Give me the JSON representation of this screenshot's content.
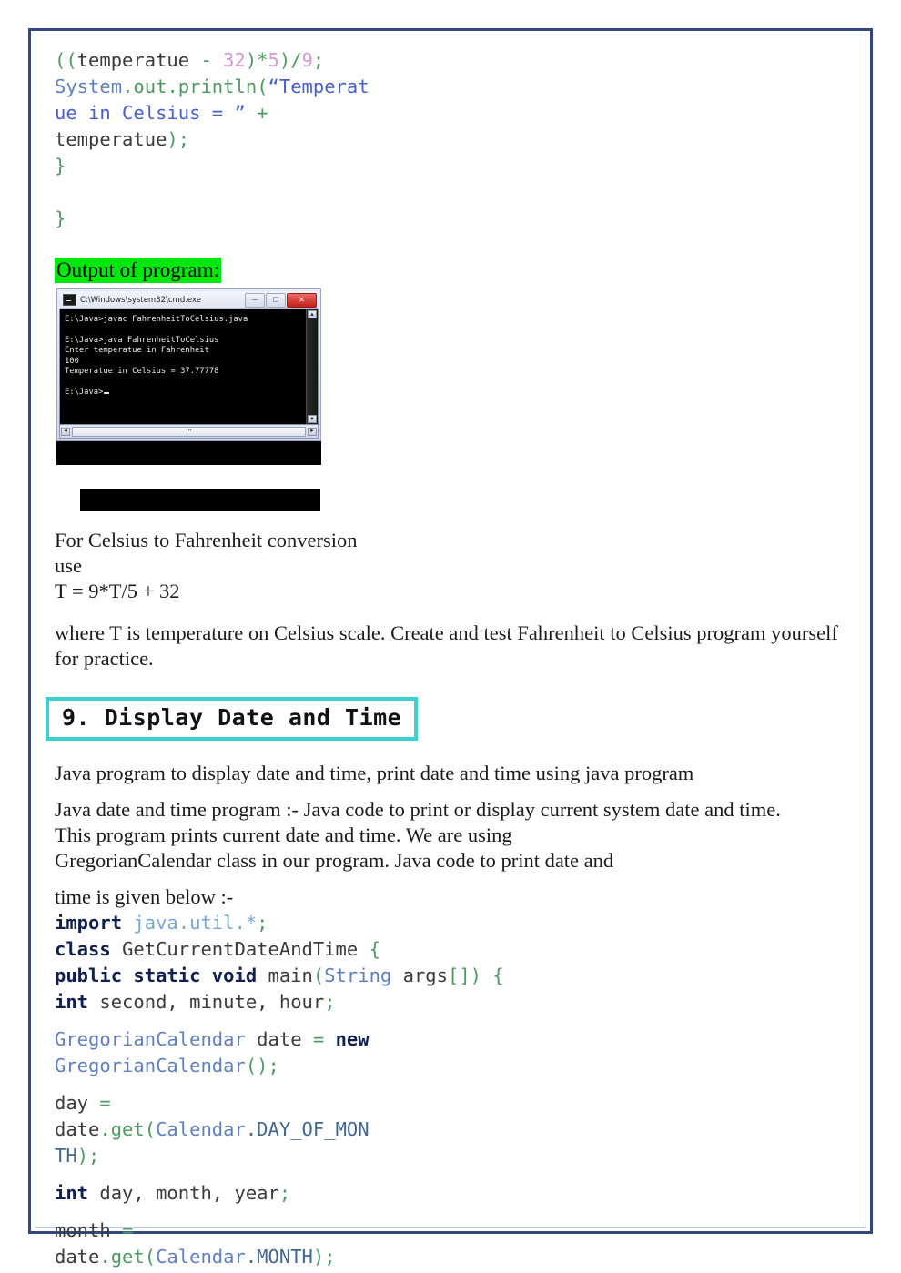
{
  "page": {
    "frame_color": "#33497e",
    "accent_heading_border": "#3ecfcf",
    "highlight_green": "#00e810"
  },
  "code_block_top": {
    "lines": [
      [
        {
          "t": "((",
          "c": "punc"
        },
        {
          "t": "temperatue ",
          "c": "id"
        },
        {
          "t": "- ",
          "c": "punc"
        },
        {
          "t": "32",
          "c": "num"
        },
        {
          "t": ")*",
          "c": "punc"
        },
        {
          "t": "5",
          "c": "num"
        },
        {
          "t": ")/",
          "c": "punc"
        },
        {
          "t": "9",
          "c": "num"
        },
        {
          "t": ";",
          "c": "punc"
        }
      ],
      [
        {
          "t": "System",
          "c": "cls"
        },
        {
          "t": ".out",
          "c": "mem"
        },
        {
          "t": ".println",
          "c": "mem"
        },
        {
          "t": "(",
          "c": "punc"
        },
        {
          "t": "“Temperat",
          "c": "str"
        }
      ],
      [
        {
          "t": "ue in Celsius = ” ",
          "c": "str"
        },
        {
          "t": "+",
          "c": "punc"
        }
      ],
      [
        {
          "t": "temperatue",
          "c": "id"
        },
        {
          "t": ");",
          "c": "punc"
        }
      ],
      [
        {
          "t": "}",
          "c": "punc"
        }
      ],
      [
        {
          "t": "",
          "c": "punc"
        }
      ],
      [
        {
          "t": "}",
          "c": "punc"
        }
      ]
    ]
  },
  "output_label": "Output of program:",
  "console": {
    "title": "C:\\Windows\\system32\\cmd.exe",
    "buttons": {
      "minimize": "—",
      "maximize": "□",
      "close": "✕"
    },
    "scroll": {
      "up_arrow": "▲",
      "down_arrow": "▼",
      "left_arrow": "◄",
      "right_arrow": "►",
      "thumb_grip": "•••"
    },
    "lines": [
      "E:\\Java>javac FahrenheitToCelsius.java",
      "",
      "E:\\Java>java FahrenheitToCelsius",
      "Enter temperatue in Fahrenheit",
      "100",
      "Temperatue in Celsius = 37.77778",
      "",
      "E:\\Java>"
    ]
  },
  "note": {
    "line1": "For Celsius to Fahrenheit conversion",
    "line2": "use",
    "line3": "T = 9*T/5 + 32",
    "paragraph": "where T is temperature on Celsius scale. Create and test Fahrenheit to Celsius program yourself for practice."
  },
  "section": {
    "heading": "9. Display Date and Time",
    "intro": "Java program to display date and time, print date and time using java program",
    "body": "Java date and time program :- Java code to print or display current system date and time.\nThis program prints current date and time. We are using\nGregorianCalendar class in our program. Java code to print date and",
    "body_tail": "time is given below :-"
  },
  "code_block_bottom": {
    "lines": [
      [
        {
          "t": "import ",
          "c": "kw"
        },
        {
          "t": "java.util.*",
          "c": "pkg"
        },
        {
          "t": ";",
          "c": "punc"
        }
      ],
      [
        {
          "t": "class ",
          "c": "kw"
        },
        {
          "t": "GetCurrentDateAndTime ",
          "c": "id"
        },
        {
          "t": "{",
          "c": "punc"
        }
      ],
      [
        {
          "t": "public static void ",
          "c": "kw"
        },
        {
          "t": "main",
          "c": "id"
        },
        {
          "t": "(",
          "c": "punc"
        },
        {
          "t": "String",
          "c": "cls"
        },
        {
          "t": " args",
          "c": "id"
        },
        {
          "t": "[]) {",
          "c": "punc"
        }
      ],
      [
        {
          "t": "int ",
          "c": "kw"
        },
        {
          "t": "second, minute, hour",
          "c": "id"
        },
        {
          "t": ";",
          "c": "punc"
        }
      ],
      [],
      [
        {
          "t": "GregorianCalendar",
          "c": "cls"
        },
        {
          "t": " date ",
          "c": "id"
        },
        {
          "t": "= ",
          "c": "punc"
        },
        {
          "t": "new",
          "c": "kw"
        }
      ],
      [
        {
          "t": "GregorianCalendar",
          "c": "cls"
        },
        {
          "t": "();",
          "c": "punc"
        }
      ],
      [],
      [
        {
          "t": "day ",
          "c": "id"
        },
        {
          "t": "=",
          "c": "punc"
        }
      ],
      [
        {
          "t": "date",
          "c": "id"
        },
        {
          "t": ".get",
          "c": "mem"
        },
        {
          "t": "(",
          "c": "punc"
        },
        {
          "t": "Calendar",
          "c": "cls"
        },
        {
          "t": ".DAY_OF_MON",
          "c": "const"
        }
      ],
      [
        {
          "t": "TH",
          "c": "const"
        },
        {
          "t": ");",
          "c": "punc"
        }
      ],
      [],
      [
        {
          "t": "int ",
          "c": "kw"
        },
        {
          "t": "day, month, year",
          "c": "id"
        },
        {
          "t": ";",
          "c": "punc"
        }
      ],
      [],
      [
        {
          "t": "month ",
          "c": "id"
        },
        {
          "t": "=",
          "c": "punc"
        }
      ],
      [
        {
          "t": "date",
          "c": "id"
        },
        {
          "t": ".get",
          "c": "mem"
        },
        {
          "t": "(",
          "c": "punc"
        },
        {
          "t": "Calendar",
          "c": "cls"
        },
        {
          "t": ".MONTH",
          "c": "const"
        },
        {
          "t": ");",
          "c": "punc"
        }
      ]
    ]
  }
}
